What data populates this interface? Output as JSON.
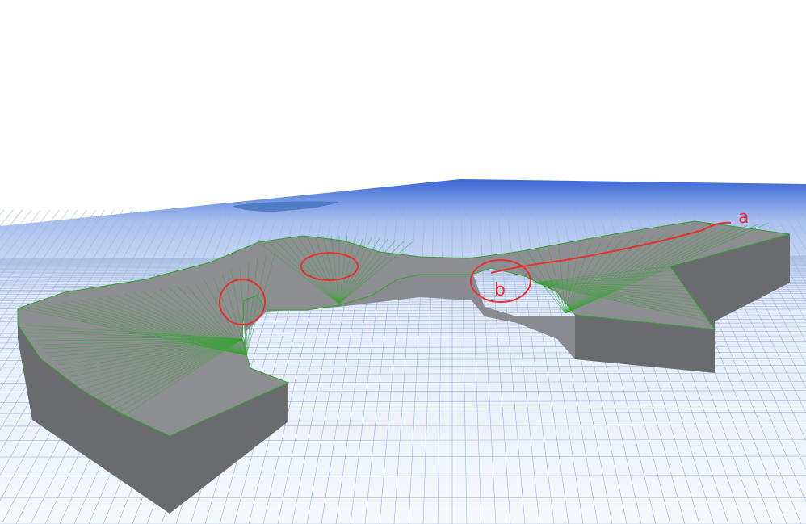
{
  "annotations": {
    "a": "a",
    "b": "b"
  },
  "colors": {
    "grid_line": "#9fb6dd",
    "horizon_blue": "#2f5fd0",
    "top_face": "#8d8e92",
    "side_face": "#6a6b6f",
    "mesh_green": "#2fa52a",
    "annotation_red": "#e8302c"
  }
}
